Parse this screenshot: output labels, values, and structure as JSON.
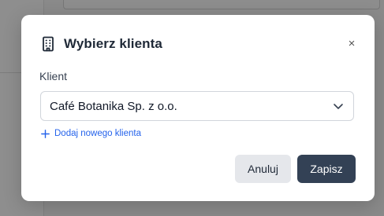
{
  "dialog": {
    "title": "Wybierz klienta",
    "close_label": "×",
    "field_label": "Klient",
    "selected_client": "Café Botanika Sp. z o.o.",
    "add_client_link": "Dodaj nowego klienta",
    "cancel_label": "Anuluj",
    "save_label": "Zapisz"
  },
  "icons": {
    "title_icon": "building-icon",
    "select_icon": "chevron-down-icon",
    "add_icon": "plus-icon"
  },
  "colors": {
    "primary_button": "#334155",
    "link": "#2563eb",
    "secondary_button": "#e5e7eb"
  }
}
